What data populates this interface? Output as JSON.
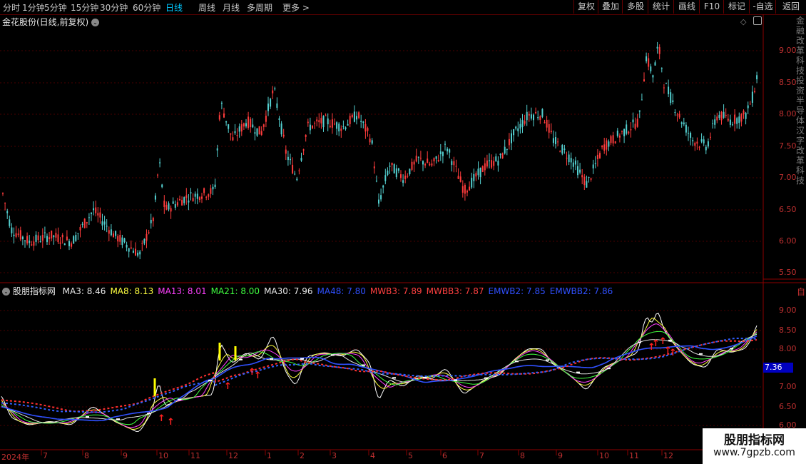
{
  "toolbar": {
    "periods": [
      "分时",
      "1分钟",
      "5分钟",
      "15分钟",
      "30分钟",
      "60分钟",
      "日线",
      "周线",
      "月线",
      "多周期",
      "更多 >"
    ],
    "active_period": "日线",
    "right_buttons": [
      "复权",
      "叠加",
      "多股",
      "统计",
      "画线",
      "F10",
      "标记",
      "-自选",
      "返回"
    ]
  },
  "upper": {
    "title": "金花股份(日线,前复权)",
    "price_labels": [
      "9.00",
      "8.50",
      "8.00",
      "7.50",
      "7.00",
      "6.50",
      "6.00",
      "5.50"
    ],
    "side_text": "金融改革科技投资半导体汉字改革科技"
  },
  "lower": {
    "indicator_name": "股朋指标网",
    "legend": [
      {
        "text": "MA3: 8.46",
        "color": "#e8e8e8"
      },
      {
        "text": "MA8: 8.13",
        "color": "#ffff40"
      },
      {
        "text": "MA13: 8.01",
        "color": "#ff40ff"
      },
      {
        "text": "MA21: 8.00",
        "color": "#40ff40"
      },
      {
        "text": "MA30: 7.96",
        "color": "#e8e8e8"
      },
      {
        "text": "MA48: 7.80",
        "color": "#3050ff"
      },
      {
        "text": "MWB3: 7.89",
        "color": "#ff4040"
      },
      {
        "text": "MWBB3: 7.87",
        "color": "#ff4040"
      },
      {
        "text": "EMWB2: 7.85",
        "color": "#3050ff"
      },
      {
        "text": "EMWBB2: 7.86",
        "color": "#3050ff"
      }
    ],
    "price_labels": [
      "9.00",
      "8.50",
      "8.00",
      "7.00",
      "6.50",
      "6.00"
    ],
    "current_value": "7.36",
    "side_char": "自"
  },
  "x_axis": {
    "year_label": "2024年",
    "months": [
      "7",
      "8",
      "9",
      "10",
      "11",
      "12",
      "1",
      "2",
      "3",
      "4",
      "5",
      "6",
      "7",
      "8",
      "9",
      "10",
      "11",
      "12"
    ]
  },
  "watermark": {
    "title": "股朋指标网",
    "url": "www.7gpzb.com"
  },
  "colors": {
    "up": "#ff3c3c",
    "down": "#54d0d0",
    "axis": "#8b0000",
    "grid": "#5a0000"
  }
}
